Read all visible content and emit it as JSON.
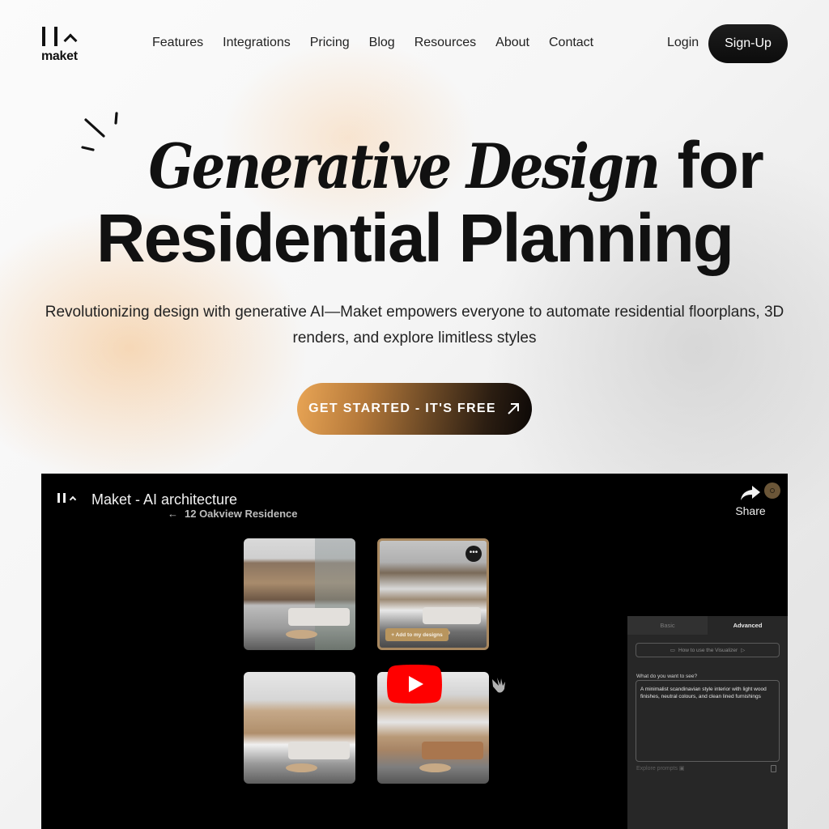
{
  "brand": {
    "name": "maket",
    "colors": {
      "accent_orange": "#e9a555",
      "dark": "#111111",
      "youtube_red": "#ff0000",
      "gold": "#b8955e"
    }
  },
  "header": {
    "nav": [
      {
        "label": "Features"
      },
      {
        "label": "Integrations"
      },
      {
        "label": "Pricing"
      },
      {
        "label": "Blog"
      },
      {
        "label": "Resources"
      },
      {
        "label": "About"
      },
      {
        "label": "Contact"
      }
    ],
    "login_label": "Login",
    "signup_label": "Sign-Up"
  },
  "hero": {
    "title_italic": "Generative Design",
    "title_rest_line1": "for",
    "title_line2": "Residential Planning",
    "subtitle": "Revolutionizing design with generative AI—Maket empowers everyone to automate residential floorplans, 3D renders, and explore limitless styles",
    "cta_label": "GET STARTED - IT'S FREE",
    "cta_icon": "arrow-up-right-icon"
  },
  "video": {
    "title": "Maket - AI architecture",
    "project_name": "12 Oakview Residence",
    "back_arrow": "←",
    "share_label": "Share",
    "more_label": "•••",
    "add_to_designs_label": "+ Add to my designs",
    "play_icon": "youtube-play-icon",
    "panel": {
      "tabs": [
        {
          "label": "Basic"
        },
        {
          "label": "Advanced",
          "active": true
        }
      ],
      "howto_label": "How to use the Visualizer",
      "question_label": "What do you want to see?",
      "prompt_value": "A minimalist scandinavian style interior with light wood finishes, neutral colours, and clean lined furnishings",
      "explore_label": "Explore prompts"
    }
  }
}
